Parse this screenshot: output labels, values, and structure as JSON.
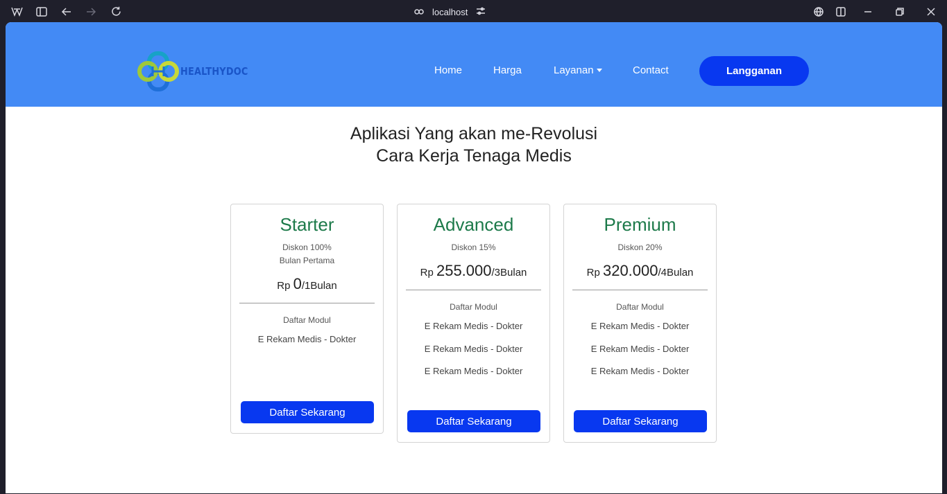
{
  "browser": {
    "url": "localhost"
  },
  "site": {
    "brand": "HEALTHYDOC",
    "nav": {
      "home": "Home",
      "harga": "Harga",
      "layanan": "Layanan",
      "contact": "Contact",
      "subscribe": "Langganan"
    },
    "hero": {
      "line1": "Aplikasi Yang akan me-Revolusi",
      "line2": "Cara Kerja Tenaga Medis"
    },
    "plans": [
      {
        "name": "Starter",
        "discount": "Diskon 100%",
        "discount_note": "Bulan Pertama",
        "currency": "Rp",
        "price": "0",
        "period": "/1Bulan",
        "modules_heading": "Daftar Modul",
        "modules": [
          "E Rekam Medis - Dokter"
        ],
        "cta": "Daftar Sekarang"
      },
      {
        "name": "Advanced",
        "discount": "Diskon 15%",
        "currency": "Rp",
        "price": "255.000",
        "period": "/3Bulan",
        "modules_heading": "Daftar Modul",
        "modules": [
          "E Rekam Medis - Dokter",
          "E Rekam Medis - Dokter",
          "E Rekam Medis - Dokter"
        ],
        "cta": "Daftar Sekarang"
      },
      {
        "name": "Premium",
        "discount": "Diskon 20%",
        "currency": "Rp",
        "price": "320.000",
        "period": "/4Bulan",
        "modules_heading": "Daftar Modul",
        "modules": [
          "E Rekam Medis - Dokter",
          "E Rekam Medis - Dokter",
          "E Rekam Medis - Dokter"
        ],
        "cta": "Daftar Sekarang"
      }
    ]
  },
  "colors": {
    "navbar": "#438af5",
    "primary_button": "#0838f0",
    "plan_title": "#1d7a4a"
  }
}
